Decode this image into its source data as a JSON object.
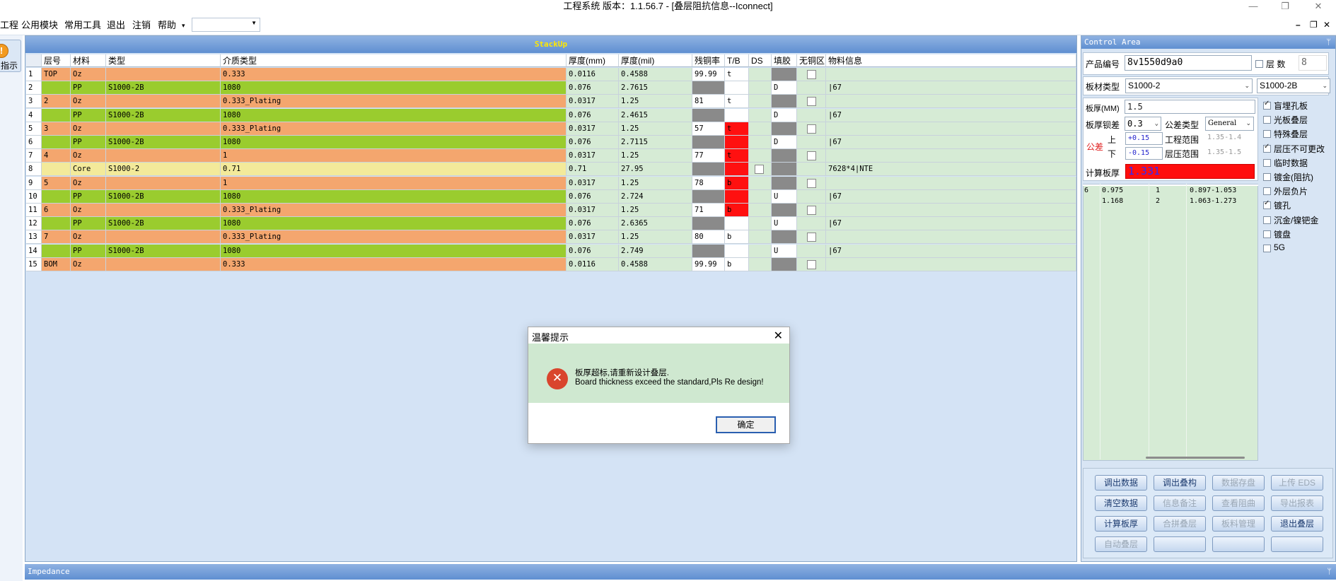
{
  "window": {
    "title": "工程系统   版本：1.1.56.7 - [叠层阻抗信息--Iconnect]",
    "controls": [
      "—",
      "❐",
      "✕"
    ],
    "mdi_controls": [
      "–",
      "❐",
      "✕"
    ]
  },
  "menu": {
    "items": [
      "工程",
      "公用模块",
      "常用工具",
      "退出",
      "注销",
      "帮助"
    ],
    "overflow": "▾",
    "combo_value": ""
  },
  "left": {
    "hint_label": "指示"
  },
  "stackup": {
    "title": "StackUp",
    "columns": [
      "层号",
      "材料",
      "类型",
      "介质类型",
      "厚度(mm)",
      "厚度(mil)",
      "残铜率",
      "T/B",
      "DS",
      "填胶",
      "无铜区",
      "物料信息"
    ],
    "rows": [
      {
        "idx": "1",
        "layer": "TOP",
        "material": "Oz",
        "type": "",
        "dielectric": "0.333",
        "th_mm": "0.0116",
        "th_mil": "0.4588",
        "cu": "99.99",
        "tb": "t",
        "tb_red": false,
        "cu_gray": false,
        "ds": "",
        "fill": "gray",
        "nocu": true,
        "info": "",
        "color": "#f4a66e"
      },
      {
        "idx": "2",
        "layer": "",
        "material": "PP",
        "type": "S1000-2B",
        "dielectric": "1080",
        "th_mm": "0.076",
        "th_mil": "2.7615",
        "cu": "",
        "tb": "",
        "tb_red": false,
        "cu_gray": true,
        "ds": "",
        "fill": "D",
        "nocu": false,
        "info": "|67",
        "color": "#9acc2e"
      },
      {
        "idx": "3",
        "layer": "2",
        "material": "Oz",
        "type": "",
        "dielectric": "0.333_Plating",
        "th_mm": "0.0317",
        "th_mil": "1.25",
        "cu": "81",
        "tb": "t",
        "tb_red": false,
        "cu_gray": false,
        "ds": "",
        "fill": "gray",
        "nocu": true,
        "info": "",
        "color": "#f4a66e"
      },
      {
        "idx": "4",
        "layer": "",
        "material": "PP",
        "type": "S1000-2B",
        "dielectric": "1080",
        "th_mm": "0.076",
        "th_mil": "2.4615",
        "cu": "",
        "tb": "",
        "tb_red": false,
        "cu_gray": true,
        "ds": "",
        "fill": "D",
        "nocu": false,
        "info": "|67",
        "color": "#9acc2e"
      },
      {
        "idx": "5",
        "layer": "3",
        "material": "Oz",
        "type": "",
        "dielectric": "0.333_Plating",
        "th_mm": "0.0317",
        "th_mil": "1.25",
        "cu": "57",
        "tb": "t",
        "tb_red": true,
        "cu_gray": false,
        "ds": "",
        "fill": "gray",
        "nocu": true,
        "info": "",
        "color": "#f4a66e"
      },
      {
        "idx": "6",
        "layer": "",
        "material": "PP",
        "type": "S1000-2B",
        "dielectric": "1080",
        "th_mm": "0.076",
        "th_mil": "2.7115",
        "cu": "",
        "tb": "",
        "tb_red": true,
        "cu_gray": true,
        "ds": "",
        "fill": "D",
        "nocu": false,
        "info": "|67",
        "color": "#9acc2e"
      },
      {
        "idx": "7",
        "layer": "4",
        "material": "Oz",
        "type": "",
        "dielectric": "1",
        "th_mm": "0.0317",
        "th_mil": "1.25",
        "cu": "77",
        "tb": "t",
        "tb_red": true,
        "cu_gray": false,
        "ds": "",
        "fill": "gray",
        "nocu": true,
        "info": "",
        "color": "#f4a66e"
      },
      {
        "idx": "8",
        "layer": "",
        "material": "Core",
        "type": "S1000-2",
        "dielectric": "0.71",
        "th_mm": "0.71",
        "th_mil": "27.95",
        "cu": "",
        "tb": "",
        "tb_red": true,
        "cu_gray": true,
        "ds": "box",
        "fill": "gray",
        "nocu": false,
        "info": "7628*4|NTE",
        "color": "#f3ea9a"
      },
      {
        "idx": "9",
        "layer": "5",
        "material": "Oz",
        "type": "",
        "dielectric": "1",
        "th_mm": "0.0317",
        "th_mil": "1.25",
        "cu": "78",
        "tb": "b",
        "tb_red": true,
        "cu_gray": false,
        "ds": "",
        "fill": "gray",
        "nocu": true,
        "info": "",
        "color": "#f4a66e"
      },
      {
        "idx": "10",
        "layer": "",
        "material": "PP",
        "type": "S1000-2B",
        "dielectric": "1080",
        "th_mm": "0.076",
        "th_mil": "2.724",
        "cu": "",
        "tb": "",
        "tb_red": true,
        "cu_gray": true,
        "ds": "",
        "fill": "U",
        "nocu": false,
        "info": "|67",
        "color": "#9acc2e"
      },
      {
        "idx": "11",
        "layer": "6",
        "material": "Oz",
        "type": "",
        "dielectric": "0.333_Plating",
        "th_mm": "0.0317",
        "th_mil": "1.25",
        "cu": "71",
        "tb": "b",
        "tb_red": true,
        "cu_gray": false,
        "ds": "",
        "fill": "gray",
        "nocu": true,
        "info": "",
        "color": "#f4a66e"
      },
      {
        "idx": "12",
        "layer": "",
        "material": "PP",
        "type": "S1000-2B",
        "dielectric": "1080",
        "th_mm": "0.076",
        "th_mil": "2.6365",
        "cu": "",
        "tb": "",
        "tb_red": false,
        "cu_gray": true,
        "ds": "",
        "fill": "U",
        "nocu": false,
        "info": "|67",
        "color": "#9acc2e"
      },
      {
        "idx": "13",
        "layer": "7",
        "material": "Oz",
        "type": "",
        "dielectric": "0.333_Plating",
        "th_mm": "0.0317",
        "th_mil": "1.25",
        "cu": "80",
        "tb": "b",
        "tb_red": false,
        "cu_gray": false,
        "ds": "",
        "fill": "gray",
        "nocu": true,
        "info": "",
        "color": "#f4a66e"
      },
      {
        "idx": "14",
        "layer": "",
        "material": "PP",
        "type": "S1000-2B",
        "dielectric": "1080",
        "th_mm": "0.076",
        "th_mil": "2.749",
        "cu": "",
        "tb": "",
        "tb_red": false,
        "cu_gray": true,
        "ds": "",
        "fill": "U",
        "nocu": false,
        "info": "|67",
        "color": "#9acc2e"
      },
      {
        "idx": "15",
        "layer": "BOM",
        "material": "Oz",
        "type": "",
        "dielectric": "0.333",
        "th_mm": "0.0116",
        "th_mil": "0.4588",
        "cu": "99.99",
        "tb": "b",
        "tb_red": false,
        "cu_gray": false,
        "ds": "",
        "fill": "gray",
        "nocu": true,
        "info": "",
        "color": "#f4a66e"
      }
    ]
  },
  "impedance": {
    "title": "Impedance",
    "pin": "ᛘ"
  },
  "control": {
    "title": "Control Area",
    "pin": "ᛘ",
    "product_label": "产品编号",
    "product_value": "8v1550d9a0",
    "layers_label": "层 数",
    "layers_value": "8",
    "material_label": "板材类型",
    "material_value": "S1000-2",
    "material_value2": "S1000-2B",
    "thick_label": "板厚(MM)",
    "thick_value": "1.5",
    "tol_label": "板厚钡差",
    "tol_value": "0.3",
    "tol_type_label": "公差类型",
    "tol_type_value": "General",
    "tolerance_label": "公差",
    "upper_label": "上",
    "upper_value": "+0.15",
    "lower_label": "下",
    "lower_value": "-0.15",
    "eng_range_label": "工程范围",
    "eng_range_value": "1.35-1.4",
    "press_range_label": "层压范围",
    "press_range_value": "1.35-1.5",
    "calc_label": "计算板厚",
    "calc_value": "1.331",
    "list_rows": [
      {
        "a": "6",
        "b": "0.975",
        "c": "1",
        "d": "0.897-1.053"
      },
      {
        "a": "",
        "b": "1.168",
        "c": "2",
        "d": "1.063-1.273"
      }
    ],
    "options": [
      {
        "label": "盲埋孔板",
        "checked": true
      },
      {
        "label": "光板叠层",
        "checked": false
      },
      {
        "label": "特殊叠层",
        "checked": false
      },
      {
        "label": "层压不可更改",
        "checked": true
      },
      {
        "label": "临时数据",
        "checked": false
      },
      {
        "label": "镀金(阻抗)",
        "checked": false
      },
      {
        "label": "外层负片",
        "checked": false
      },
      {
        "label": "镀孔",
        "checked": true
      },
      {
        "label": "沉金/镍钯金",
        "checked": false
      },
      {
        "label": "镀盘",
        "checked": false
      },
      {
        "label": "5G",
        "checked": false
      }
    ],
    "buttons": [
      {
        "label": "调出数据",
        "enabled": true
      },
      {
        "label": "调出叠构",
        "enabled": true
      },
      {
        "label": "数据存盘",
        "enabled": false
      },
      {
        "label": "上传 EDS",
        "enabled": false
      },
      {
        "label": "清空数据",
        "enabled": true
      },
      {
        "label": "信息备注",
        "enabled": false
      },
      {
        "label": "查看阻曲",
        "enabled": false
      },
      {
        "label": "导出报表",
        "enabled": false
      },
      {
        "label": "计算板厚",
        "enabled": true
      },
      {
        "label": "合拼叠层",
        "enabled": false
      },
      {
        "label": "板料管理",
        "enabled": false
      },
      {
        "label": "退出叠层",
        "enabled": true
      },
      {
        "label": "自动叠层",
        "enabled": false
      },
      {
        "label": "",
        "enabled": false
      },
      {
        "label": "",
        "enabled": false
      },
      {
        "label": "",
        "enabled": false
      }
    ]
  },
  "dialog": {
    "title": "温馨提示",
    "message_cn": "板厚超标,请重新设计叠层.",
    "message_en": "Board thickness exceed the standard,Pls Re design!",
    "ok_label": "确定"
  },
  "colors": {
    "oz_row": "#f4a66e",
    "pp_row": "#9acc2e",
    "core_row": "#f3ea9a",
    "data_cell": "#d6ebd5",
    "red_cell": "#ff1010",
    "gray_cell": "#8a8a8a",
    "header_blue": "#6a99d6"
  }
}
